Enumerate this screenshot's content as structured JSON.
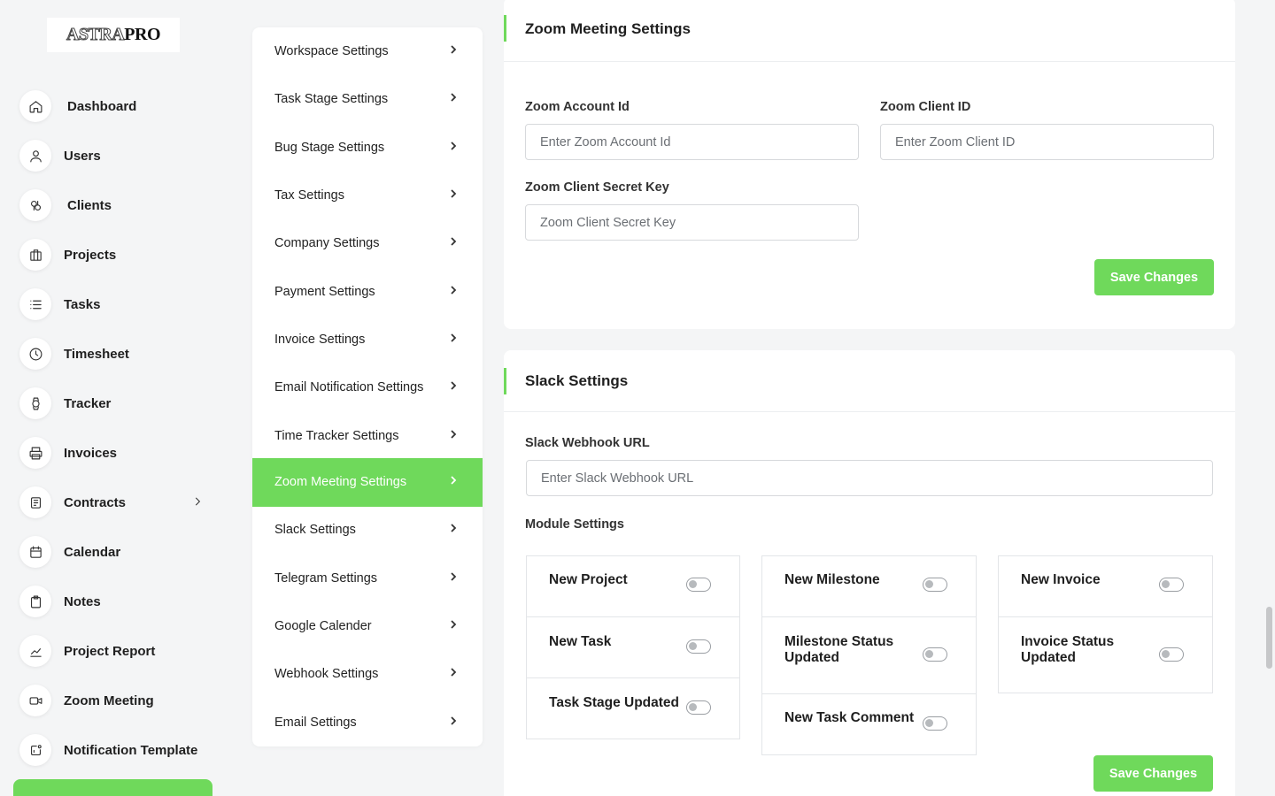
{
  "brand": {
    "logo_part1": "ASTRA",
    "logo_part2": "PRO"
  },
  "sidebar": {
    "items": [
      {
        "label": "Dashboard",
        "icon": "home-icon"
      },
      {
        "label": "Users",
        "icon": "user-icon"
      },
      {
        "label": "Clients",
        "icon": "clients-icon"
      },
      {
        "label": "Projects",
        "icon": "projects-icon"
      },
      {
        "label": "Tasks",
        "icon": "list-icon"
      },
      {
        "label": "Timesheet",
        "icon": "clock-icon"
      },
      {
        "label": "Tracker",
        "icon": "watch-icon"
      },
      {
        "label": "Invoices",
        "icon": "printer-icon"
      },
      {
        "label": "Contracts",
        "icon": "contract-icon"
      },
      {
        "label": "Calendar",
        "icon": "calendar-icon"
      },
      {
        "label": "Notes",
        "icon": "clipboard-icon"
      },
      {
        "label": "Project Report",
        "icon": "chart-icon"
      },
      {
        "label": "Zoom Meeting",
        "icon": "video-icon"
      },
      {
        "label": "Notification Template",
        "icon": "notification-icon"
      }
    ]
  },
  "settings_menu": {
    "items": [
      "Workspace Settings",
      "Task Stage Settings",
      "Bug Stage Settings",
      "Tax Settings",
      "Company Settings",
      "Payment Settings",
      "Invoice Settings",
      "Email Notification Settings",
      "Time Tracker Settings",
      "Zoom Meeting Settings",
      "Slack Settings",
      "Telegram Settings",
      "Google Calender",
      "Webhook Settings",
      "Email Settings"
    ],
    "active": "Zoom Meeting Settings"
  },
  "zoom": {
    "title": "Zoom Meeting Settings",
    "account_id_label": "Zoom Account Id",
    "account_id_placeholder": "Enter Zoom Account Id",
    "client_id_label": "Zoom Client ID",
    "client_id_placeholder": "Enter Zoom Client ID",
    "secret_label": "Zoom Client Secret Key",
    "secret_placeholder": "Zoom Client Secret Key",
    "save_label": "Save Changes"
  },
  "slack": {
    "title": "Slack Settings",
    "webhook_label": "Slack Webhook URL",
    "webhook_placeholder": "Enter Slack Webhook URL",
    "module_label": "Module Settings",
    "modules": {
      "col1": [
        "New Project",
        "New Task",
        "Task Stage Updated"
      ],
      "col2": [
        "New Milestone",
        "Milestone Status Updated",
        "New Task Comment"
      ],
      "col3": [
        "New Invoice",
        "Invoice Status Updated"
      ]
    },
    "toggles_on": false,
    "save_label": "Save Changes"
  },
  "colors": {
    "accent": "#6fd95b",
    "background": "#f4f5f6"
  }
}
